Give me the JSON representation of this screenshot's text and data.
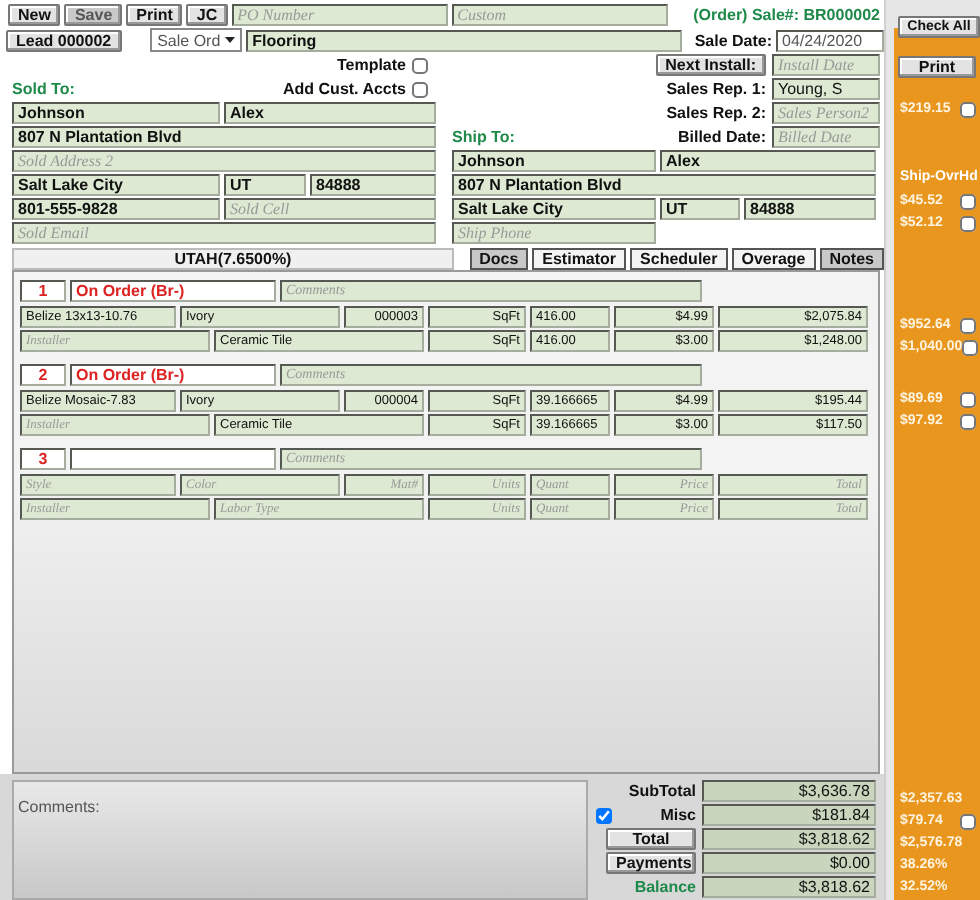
{
  "toolbar": {
    "buttons": [
      {
        "label": "New",
        "disabled": false
      },
      {
        "label": "Save",
        "disabled": true
      },
      {
        "label": "Print",
        "disabled": false
      },
      {
        "label": "JC",
        "disabled": false
      }
    ],
    "po_number": {
      "placeholder": "PO Number"
    },
    "custom": {
      "placeholder": "Custom"
    },
    "sale_number": "(Order) Sale#: BR000002"
  },
  "header": {
    "lead": "Lead 000002",
    "sale_type": "Sale Ord",
    "job_type": {
      "value": "Flooring"
    },
    "sale_date_label": "Sale Date:",
    "sale_date": {
      "value": "04/24/2020"
    }
  },
  "options": [
    {
      "label": "Template",
      "checked": false
    },
    {
      "label": "Add Cust. Accts",
      "checked": false
    }
  ],
  "sold_to": {
    "title": "Sold To:",
    "rows": [
      [
        {
          "value": "Johnson"
        },
        {
          "value": "Alex"
        }
      ],
      [
        {
          "value": "807 N Plantation Blvd"
        }
      ],
      [
        {
          "placeholder": "Sold Address 2"
        }
      ],
      [
        {
          "value": "Salt Lake City"
        },
        {
          "value": "UT"
        },
        {
          "value": "84888"
        }
      ],
      [
        {
          "value": "801-555-9828"
        },
        {
          "placeholder": "Sold Cell"
        }
      ],
      [
        {
          "placeholder": "Sold Email"
        }
      ]
    ]
  },
  "sale_info": [
    {
      "kind": "button",
      "label": "Next Install:",
      "field": {
        "placeholder": "Install Date"
      }
    },
    {
      "kind": "label",
      "label": "Sales Rep. 1:",
      "field": {
        "value": "Young, S"
      }
    },
    {
      "kind": "label",
      "label": "Sales Rep. 2:",
      "field": {
        "placeholder": "Sales Person2"
      }
    },
    {
      "kind": "label",
      "label": "Billed Date:",
      "field": {
        "placeholder": "Billed Date"
      }
    }
  ],
  "ship_to": {
    "title": "Ship To:",
    "rows": [
      [
        {
          "value": "Johnson"
        },
        {
          "value": "Alex"
        }
      ],
      [
        {
          "value": "807 N Plantation Blvd"
        }
      ],
      [
        {
          "value": "Salt Lake City"
        },
        {
          "value": "UT"
        },
        {
          "value": "84888"
        }
      ],
      [
        {
          "placeholder": "Ship Phone"
        }
      ]
    ]
  },
  "tax": "UTAH(7.6500%)",
  "tabs": [
    {
      "label": "Docs",
      "selected": true
    },
    {
      "label": "Estimator",
      "selected": false
    },
    {
      "label": "Scheduler",
      "selected": false
    },
    {
      "label": "Overage",
      "selected": false
    },
    {
      "label": "Notes",
      "selected": true
    }
  ],
  "items": [
    {
      "number": "1",
      "status": "On Order (Br-)",
      "comments": {
        "placeholder": "Comments"
      },
      "product": [
        {
          "value": "Belize 13x13-10.76"
        },
        {
          "value": "Ivory"
        },
        {
          "value": "000003"
        },
        {
          "value": "SqFt"
        },
        {
          "value": "416.00"
        },
        {
          "value": "$4.99"
        },
        {
          "value": "$2,075.84"
        }
      ],
      "labor": [
        {
          "placeholder": "Installer"
        },
        {
          "value": "Ceramic Tile"
        },
        {
          "value": "SqFt"
        },
        {
          "value": "416.00"
        },
        {
          "value": "$3.00"
        },
        {
          "value": "$1,248.00"
        }
      ]
    },
    {
      "number": "2",
      "status": "On Order (Br-)",
      "comments": {
        "placeholder": "Comments"
      },
      "product": [
        {
          "value": "Belize Mosaic-7.83"
        },
        {
          "value": "Ivory"
        },
        {
          "value": "000004"
        },
        {
          "value": "SqFt"
        },
        {
          "value": "39.166665"
        },
        {
          "value": "$4.99"
        },
        {
          "value": "$195.44"
        }
      ],
      "labor": [
        {
          "placeholder": "Installer"
        },
        {
          "value": "Ceramic Tile"
        },
        {
          "value": "SqFt"
        },
        {
          "value": "39.166665"
        },
        {
          "value": "$3.00"
        },
        {
          "value": "$117.50"
        }
      ]
    },
    {
      "number": "3",
      "comments": {
        "placeholder": "Comments"
      },
      "product": [
        {
          "placeholder": "Style"
        },
        {
          "placeholder": "Color"
        },
        {
          "placeholder": "Mat#"
        },
        {
          "placeholder": "Units"
        },
        {
          "placeholder": "Quant"
        },
        {
          "placeholder": "Price"
        },
        {
          "placeholder": "Total"
        }
      ],
      "labor": [
        {
          "placeholder": "Installer"
        },
        {
          "placeholder": "Labor Type"
        },
        {
          "placeholder": "Units"
        },
        {
          "placeholder": "Quant"
        },
        {
          "placeholder": "Price"
        },
        {
          "placeholder": "Total"
        }
      ]
    }
  ],
  "comments_label": "Comments:",
  "totals": [
    {
      "kind": "label",
      "label": "SubTotal",
      "value": "$3,636.78"
    },
    {
      "kind": "check",
      "label": "Misc",
      "checked": true,
      "value": "$181.84"
    },
    {
      "kind": "button",
      "label": "Total",
      "value": "$3,818.62"
    },
    {
      "kind": "button",
      "label": "Payments",
      "value": "$0.00"
    },
    {
      "kind": "balance",
      "label": "Balance",
      "value": "$3,818.62"
    }
  ],
  "sidebar": {
    "check_all": "Check All",
    "print": "Print",
    "groups": [
      [
        {
          "kind": "check",
          "text": "$219.15",
          "checked": false
        }
      ],
      [
        {
          "kind": "heading",
          "text": "Ship-OvrHd"
        },
        {
          "kind": "check",
          "text": "$45.52",
          "checked": false
        },
        {
          "kind": "check",
          "text": "$52.12",
          "checked": false
        }
      ],
      [
        {
          "kind": "check",
          "text": "$952.64",
          "checked": false
        },
        {
          "kind": "check",
          "text": "$1,040.00",
          "checked": false
        }
      ],
      [
        {
          "kind": "check",
          "text": "$89.69",
          "checked": false
        },
        {
          "kind": "check",
          "text": "$97.92",
          "checked": false
        }
      ],
      [
        {
          "kind": "amount",
          "text": "$2,357.63"
        },
        {
          "kind": "check",
          "text": "$79.74",
          "checked": false
        },
        {
          "kind": "amount",
          "text": "$2,576.78"
        },
        {
          "kind": "amount",
          "text": "38.26%"
        },
        {
          "kind": "amount",
          "text": "32.52%"
        }
      ]
    ]
  }
}
